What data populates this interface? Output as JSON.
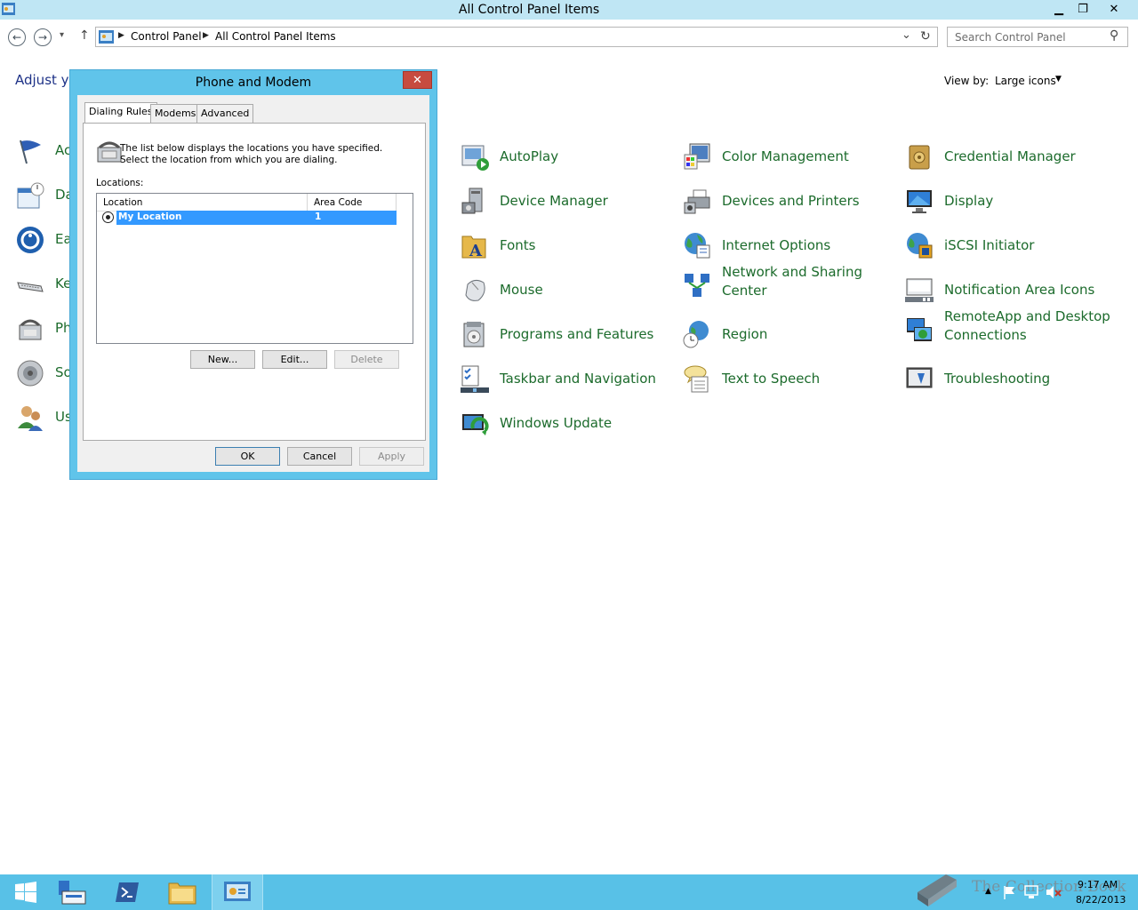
{
  "window": {
    "title": "All Control Panel Items",
    "minimize": "▁",
    "maximize": "❐",
    "close": "✕"
  },
  "nav": {
    "back": "←",
    "forward": "→",
    "recent": "▾",
    "up": "↑",
    "breadcrumb": [
      "Control Panel",
      "All Control Panel Items"
    ],
    "dropdown": "⌄",
    "refresh": "↻",
    "search_placeholder": "Search Control Panel",
    "search_icon": "⚲"
  },
  "content": {
    "heading": "Adjust yo",
    "viewby_label": "View by:",
    "viewby_value": "Large icons",
    "viewby_caret": "▼"
  },
  "left_items": [
    {
      "label": "Ac",
      "icon": "flag-icon"
    },
    {
      "label": "Da",
      "icon": "calendar-icon"
    },
    {
      "label": "Ea",
      "icon": "ease-of-access-icon"
    },
    {
      "label": "Ke",
      "icon": "keyboard-icon"
    },
    {
      "label": "Ph",
      "icon": "phone-icon"
    },
    {
      "label": "So",
      "icon": "speaker-icon"
    },
    {
      "label": "Us",
      "icon": "users-icon"
    }
  ],
  "items": [
    {
      "label": "AutoPlay",
      "icon": "autoplay-icon"
    },
    {
      "label": "Color Management",
      "icon": "color-management-icon"
    },
    {
      "label": "Credential Manager",
      "icon": "credential-manager-icon"
    },
    {
      "label": "Device Manager",
      "icon": "device-manager-icon"
    },
    {
      "label": "Devices and Printers",
      "icon": "printer-icon"
    },
    {
      "label": "Display",
      "icon": "display-icon"
    },
    {
      "label": "Fonts",
      "icon": "fonts-icon"
    },
    {
      "label": "Internet Options",
      "icon": "globe-icon"
    },
    {
      "label": "iSCSI Initiator",
      "icon": "iscsi-icon"
    },
    {
      "label": "Mouse",
      "icon": "mouse-icon"
    },
    {
      "label": "Network and Sharing Center",
      "icon": "network-icon"
    },
    {
      "label": "Notification Area Icons",
      "icon": "notification-icon"
    },
    {
      "label": "Programs and Features",
      "icon": "programs-icon"
    },
    {
      "label": "Region",
      "icon": "region-icon"
    },
    {
      "label": "RemoteApp and Desktop Connections",
      "icon": "remoteapp-icon"
    },
    {
      "label": "Taskbar and Navigation",
      "icon": "taskbar-icon"
    },
    {
      "label": "Text to Speech",
      "icon": "speech-icon"
    },
    {
      "label": "Troubleshooting",
      "icon": "troubleshooting-icon"
    },
    {
      "label": "Windows Update",
      "icon": "windows-update-icon"
    }
  ],
  "dialog": {
    "title": "Phone and Modem",
    "close": "✕",
    "tabs": [
      "Dialing Rules",
      "Modems",
      "Advanced"
    ],
    "description": "The list below displays the locations you have specified. Select the location from which you are dialing.",
    "locations_label": "Locations:",
    "columns": [
      "Location",
      "Area Code"
    ],
    "rows": [
      {
        "location": "My Location",
        "area_code": "1"
      }
    ],
    "buttons": {
      "new": "New...",
      "edit": "Edit...",
      "delete": "Delete",
      "ok": "OK",
      "cancel": "Cancel",
      "apply": "Apply"
    }
  },
  "taskbar": {
    "watermark": "The Collection Book",
    "time": "9:17 AM",
    "date": "8/22/2013"
  },
  "colors": {
    "titlebar": "#bfe6f4",
    "dialog_frame": "#60c4ea",
    "link_green": "#1c6b2c",
    "selection": "#3399ff",
    "taskbar": "#58c1e7"
  }
}
